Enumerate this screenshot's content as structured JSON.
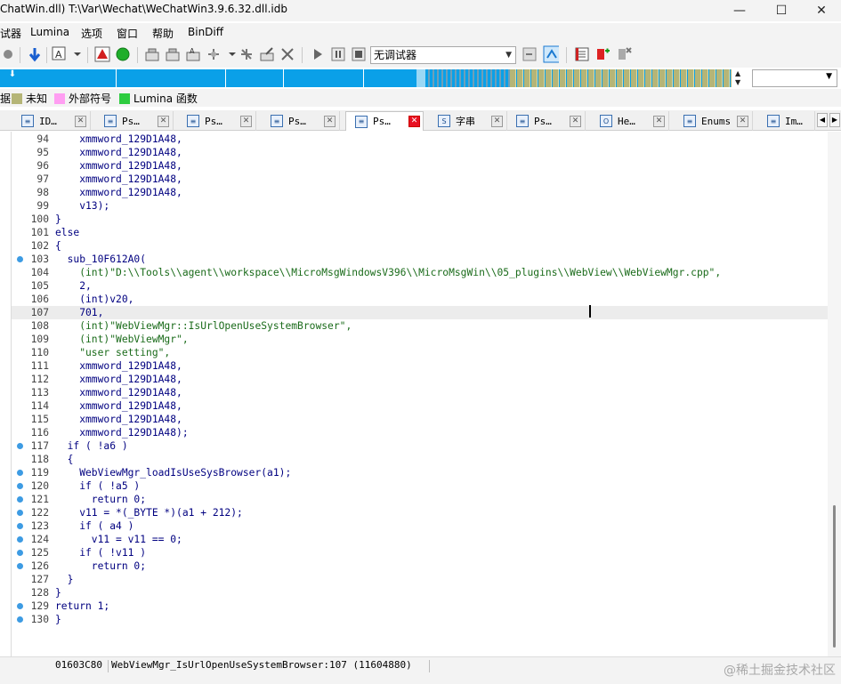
{
  "window": {
    "title": "ChatWin.dll) T:\\Var\\Wechat\\WeChatWin3.9.6.32.dll.idb",
    "minimize": "—",
    "maximize": "☐",
    "close": "✕"
  },
  "menu": [
    "试器",
    "Lumina",
    "选项",
    "窗口",
    "帮助",
    "BinDiff"
  ],
  "toolbar": {
    "debugger_select": "无调试器"
  },
  "legend": [
    {
      "label": "据",
      "color": ""
    },
    {
      "label": "未知",
      "color": "#b5b577"
    },
    {
      "label": "外部符号",
      "color": "#ff9ef2"
    },
    {
      "label": "Lumina 函数",
      "color": "#2ecc40"
    }
  ],
  "tabs": [
    {
      "label": "ID…",
      "icon": "id-icon",
      "active": false
    },
    {
      "label": "Ps…",
      "icon": "pseudocode-icon",
      "active": false
    },
    {
      "label": "Ps…",
      "icon": "pseudocode-icon",
      "active": false
    },
    {
      "label": "Ps…",
      "icon": "pseudocode-icon",
      "active": false
    },
    {
      "label": "Ps…",
      "icon": "pseudocode-icon",
      "active": true
    },
    {
      "label": "字串",
      "icon": "strings-icon",
      "active": false
    },
    {
      "label": "Ps…",
      "icon": "pseudocode-icon",
      "active": false
    },
    {
      "label": "He…",
      "icon": "hex-icon",
      "active": false
    },
    {
      "label": "Enums",
      "icon": "enums-icon",
      "active": false
    },
    {
      "label": "Im…",
      "icon": "imports-icon",
      "active": false
    }
  ],
  "code": [
    {
      "n": "94",
      "bp": false,
      "text": "    xmmword_129D1A48,"
    },
    {
      "n": "95",
      "bp": false,
      "text": "    xmmword_129D1A48,"
    },
    {
      "n": "96",
      "bp": false,
      "text": "    xmmword_129D1A48,"
    },
    {
      "n": "97",
      "bp": false,
      "text": "    xmmword_129D1A48,"
    },
    {
      "n": "98",
      "bp": false,
      "text": "    xmmword_129D1A48,"
    },
    {
      "n": "99",
      "bp": false,
      "text": "    v13);"
    },
    {
      "n": "100",
      "bp": false,
      "text": "}"
    },
    {
      "n": "101",
      "bp": false,
      "text": "else"
    },
    {
      "n": "102",
      "bp": false,
      "text": "{"
    },
    {
      "n": "103",
      "bp": true,
      "text": "  sub_10F612A0("
    },
    {
      "n": "104",
      "bp": false,
      "text": "    (int)\"D:\\\\Tools\\\\agent\\\\workspace\\\\MicroMsgWindowsV396\\\\MicroMsgWin\\\\05_plugins\\\\WebView\\\\WebViewMgr.cpp\","
    },
    {
      "n": "105",
      "bp": false,
      "text": "    2,"
    },
    {
      "n": "106",
      "bp": false,
      "text": "    (int)v20,"
    },
    {
      "n": "107",
      "bp": false,
      "text": "    701,"
    },
    {
      "n": "108",
      "bp": false,
      "text": "    (int)\"WebViewMgr::IsUrlOpenUseSystemBrowser\","
    },
    {
      "n": "109",
      "bp": false,
      "text": "    (int)\"WebViewMgr\","
    },
    {
      "n": "110",
      "bp": false,
      "text": "    \"user setting\","
    },
    {
      "n": "111",
      "bp": false,
      "text": "    xmmword_129D1A48,"
    },
    {
      "n": "112",
      "bp": false,
      "text": "    xmmword_129D1A48,"
    },
    {
      "n": "113",
      "bp": false,
      "text": "    xmmword_129D1A48,"
    },
    {
      "n": "114",
      "bp": false,
      "text": "    xmmword_129D1A48,"
    },
    {
      "n": "115",
      "bp": false,
      "text": "    xmmword_129D1A48,"
    },
    {
      "n": "116",
      "bp": false,
      "text": "    xmmword_129D1A48);"
    },
    {
      "n": "117",
      "bp": true,
      "text": "  if ( !a6 )"
    },
    {
      "n": "118",
      "bp": false,
      "text": "  {"
    },
    {
      "n": "119",
      "bp": true,
      "text": "    WebViewMgr_loadIsUseSysBrowser(a1);"
    },
    {
      "n": "120",
      "bp": true,
      "text": "    if ( !a5 )"
    },
    {
      "n": "121",
      "bp": true,
      "text": "      return 0;"
    },
    {
      "n": "122",
      "bp": true,
      "text": "    v11 = *(_BYTE *)(a1 + 212);"
    },
    {
      "n": "123",
      "bp": true,
      "text": "    if ( a4 )"
    },
    {
      "n": "124",
      "bp": true,
      "text": "      v11 = v11 == 0;"
    },
    {
      "n": "125",
      "bp": true,
      "text": "    if ( !v11 )"
    },
    {
      "n": "126",
      "bp": true,
      "text": "      return 0;"
    },
    {
      "n": "127",
      "bp": false,
      "text": "  }"
    },
    {
      "n": "128",
      "bp": false,
      "text": "}"
    },
    {
      "n": "129",
      "bp": true,
      "text": "return 1;"
    },
    {
      "n": "130",
      "bp": true,
      "text": "}"
    }
  ],
  "current_line": "107",
  "status": {
    "address": "01603C80",
    "location": "WebViewMgr_IsUrlOpenUseSystemBrowser:107 (11604880)",
    "watermark": "@稀土掘金技术社区"
  },
  "colors": {
    "nav_blue": "#0aa0e8",
    "nav_olive": "#b5b577",
    "breakpoint": "#3d9be3"
  }
}
